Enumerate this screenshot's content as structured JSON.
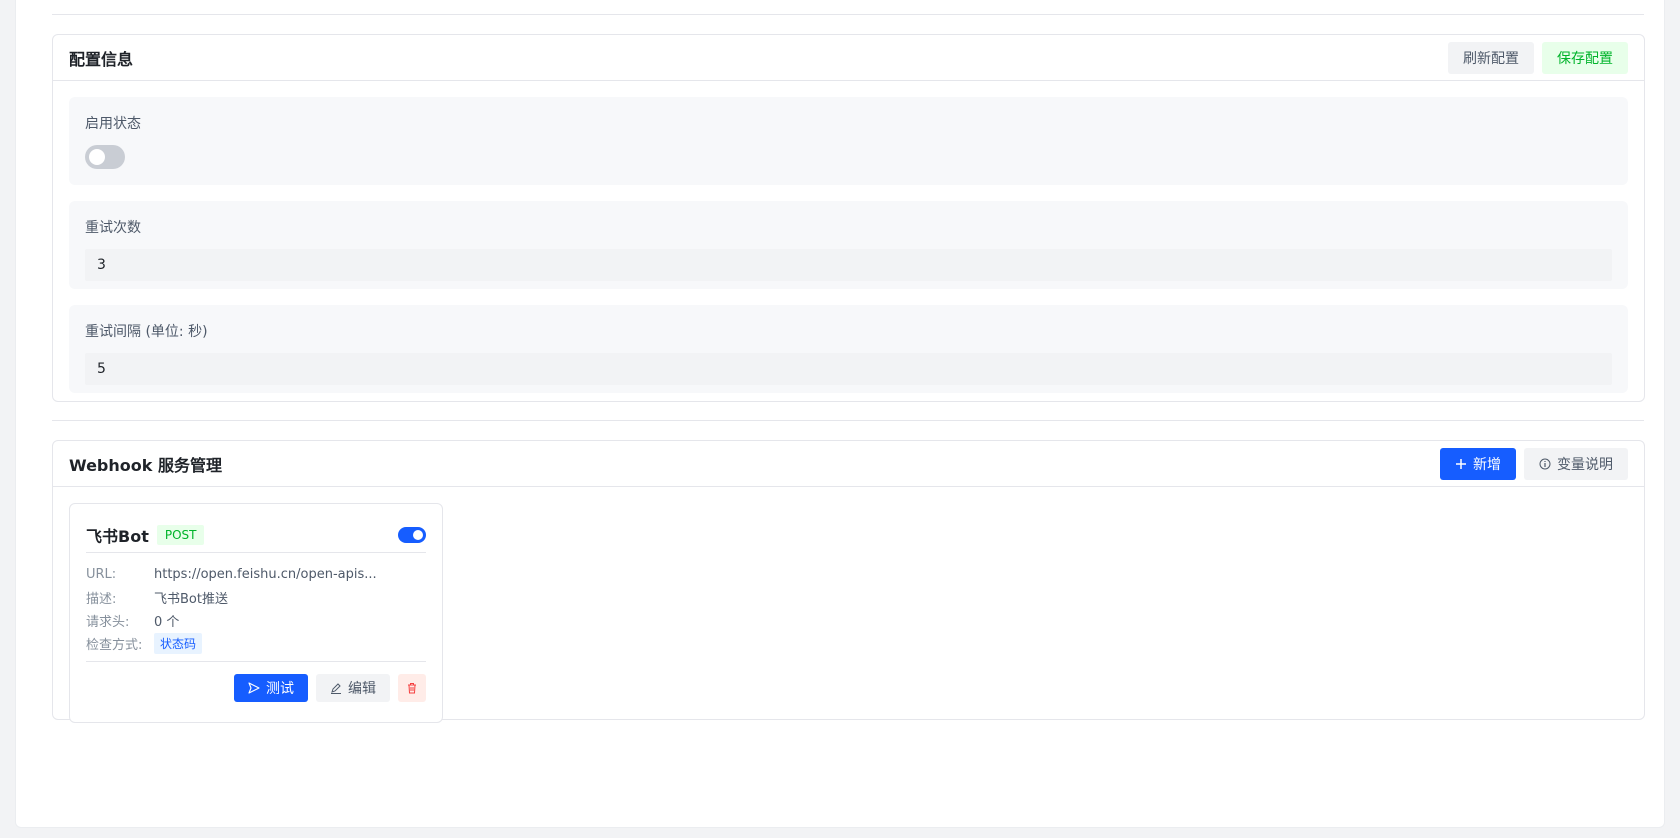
{
  "config": {
    "title": "配置信息",
    "refresh_label": "刷新配置",
    "save_label": "保存配置",
    "fields": {
      "enabled_label": "启用状态",
      "enabled": false,
      "retry_label": "重试次数",
      "retry_value": "3",
      "interval_label": "重试间隔 (单位: 秒)",
      "interval_value": "5"
    }
  },
  "webhook": {
    "title": "Webhook 服务管理",
    "add_label": "新增",
    "vars_label": "变量说明",
    "card": {
      "name": "飞书Bot",
      "method": "POST",
      "enabled": true,
      "url_key": "URL:",
      "url_value": "https://open.feishu.cn/open-apis...",
      "desc_key": "描述:",
      "desc_value": "飞书Bot推送",
      "headers_key": "请求头:",
      "headers_value": "0 个",
      "check_key": "检查方式:",
      "check_value": "状态码",
      "test_label": "测试",
      "edit_label": "编辑"
    }
  },
  "colors": {
    "primary": "#165dff",
    "success": "#00b42a",
    "danger": "#f53f3f"
  },
  "icons": [
    "plus-icon",
    "info-circle-icon",
    "send-icon",
    "edit-icon",
    "trash-icon"
  ]
}
